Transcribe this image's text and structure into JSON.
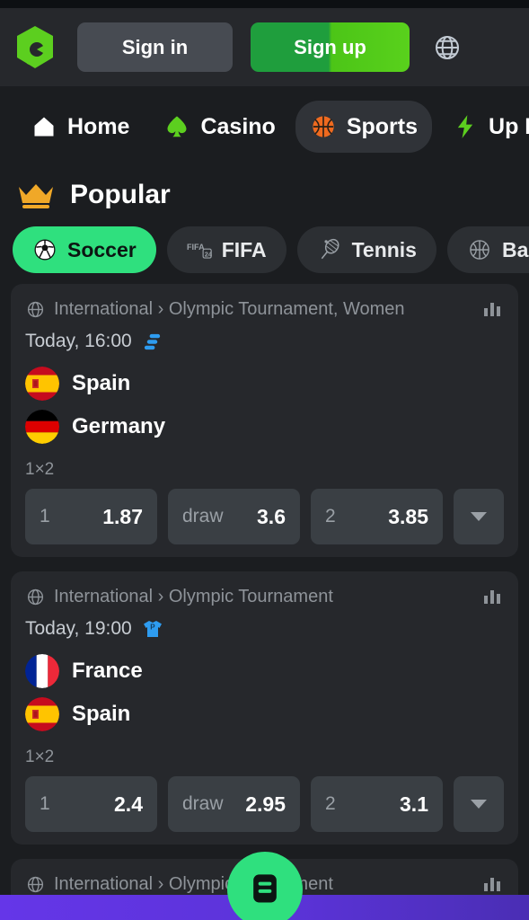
{
  "header": {
    "logo_icon": "brand-hexagon-logo",
    "sign_in_label": "Sign in",
    "sign_up_label": "Sign up",
    "language_icon": "globe-icon",
    "signup_gradient_from": "#1f9e3d",
    "signup_gradient_to": "#59d11c"
  },
  "nav": {
    "items": [
      {
        "label": "Home",
        "icon": "home-icon",
        "active": false
      },
      {
        "label": "Casino",
        "icon": "spade-icon",
        "active": false
      },
      {
        "label": "Sports",
        "icon": "basketball-icon",
        "active": true
      },
      {
        "label": "Up Down",
        "icon": "lightning-bolt-icon",
        "active": false
      }
    ]
  },
  "section": {
    "title": "Popular",
    "icon": "crown-icon",
    "crown_color": "#f0a828"
  },
  "sport_chips": [
    {
      "label": "Soccer",
      "icon": "soccer-ball-icon",
      "active": true
    },
    {
      "label": "FIFA",
      "icon": "fifa-24-icon",
      "active": false
    },
    {
      "label": "Tennis",
      "icon": "tennis-racket-icon",
      "active": false
    },
    {
      "label": "Basketball",
      "icon": "basketball-outline-icon",
      "active": false
    }
  ],
  "accent_color": "#2fe07e",
  "matches": [
    {
      "league_icon": "globe-small-icon",
      "league": "International › Olympic Tournament, Women",
      "stats_icon": "bar-chart-icon",
      "time": "Today, 16:00",
      "badge_icon": "live-stream-icon",
      "teams": [
        {
          "name": "Spain",
          "flag": "flag-spain"
        },
        {
          "name": "Germany",
          "flag": "flag-germany"
        }
      ],
      "market": "1×2",
      "odds": [
        {
          "key": "1",
          "value": "1.87"
        },
        {
          "key": "draw",
          "value": "3.6"
        },
        {
          "key": "2",
          "value": "3.85"
        }
      ],
      "more_icon": "chevron-down-icon"
    },
    {
      "league_icon": "globe-small-icon",
      "league": "International › Olympic Tournament",
      "stats_icon": "bar-chart-icon",
      "time": "Today, 19:00",
      "badge_icon": "jersey-icon",
      "teams": [
        {
          "name": "France",
          "flag": "flag-france"
        },
        {
          "name": "Spain",
          "flag": "flag-spain"
        }
      ],
      "market": "1×2",
      "odds": [
        {
          "key": "1",
          "value": "2.4"
        },
        {
          "key": "draw",
          "value": "2.95"
        },
        {
          "key": "2",
          "value": "3.1"
        }
      ],
      "more_icon": "chevron-down-icon"
    },
    {
      "league_icon": "globe-small-icon",
      "league": "International › Olympic Tournament",
      "stats_icon": "bar-chart-icon",
      "time": "",
      "badge_icon": "",
      "teams": [],
      "market": "",
      "odds": [],
      "more_icon": ""
    }
  ],
  "bottom": {
    "fab_icon": "bet-slip-icon",
    "bar_color_from": "#6536e8",
    "bar_color_to": "#4a2eb4"
  }
}
